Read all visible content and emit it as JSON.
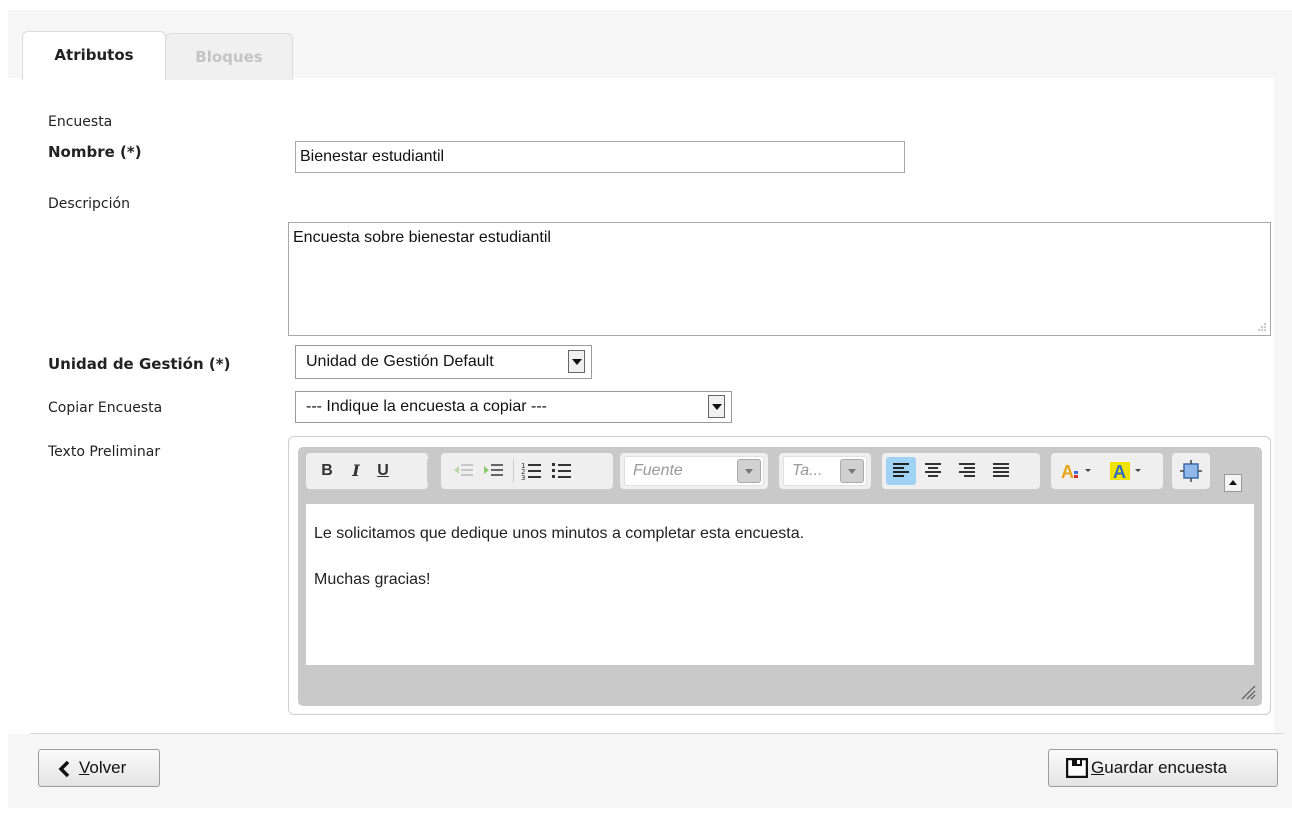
{
  "tabs": [
    {
      "label": "Atributos",
      "active": true
    },
    {
      "label": "Bloques",
      "active": false
    }
  ],
  "form": {
    "section_label": "Encuesta",
    "nombre_label": "Nombre (*)",
    "nombre_value": "Bienestar estudiantil",
    "descripcion_label": "Descripción",
    "descripcion_value": "Encuesta sobre bienestar estudiantil",
    "unidad_label": "Unidad de Gestión (*)",
    "unidad_value": "Unidad de Gestión Default",
    "copiar_label": "Copiar Encuesta",
    "copiar_value": "--- Indique la encuesta a copiar ---",
    "texto_label": "Texto Preliminar"
  },
  "editor": {
    "toolbar": {
      "bold": "B",
      "italic": "I",
      "underline": "U",
      "font_placeholder": "Fuente",
      "size_placeholder": "Ta..."
    },
    "content": [
      "Le solicitamos que dedique unos minutos a completar esta encuesta.",
      "Muchas gracias!"
    ]
  },
  "footer": {
    "back_accel": "V",
    "back_rest": "olver",
    "save_accel": "G",
    "save_rest": "uardar encuesta"
  },
  "colors": {
    "page_bg": "#f6f6f6",
    "active_align": "#9fd2f5",
    "font_color_icon": "#e8a317",
    "highlight_icon": "#f2e200"
  }
}
